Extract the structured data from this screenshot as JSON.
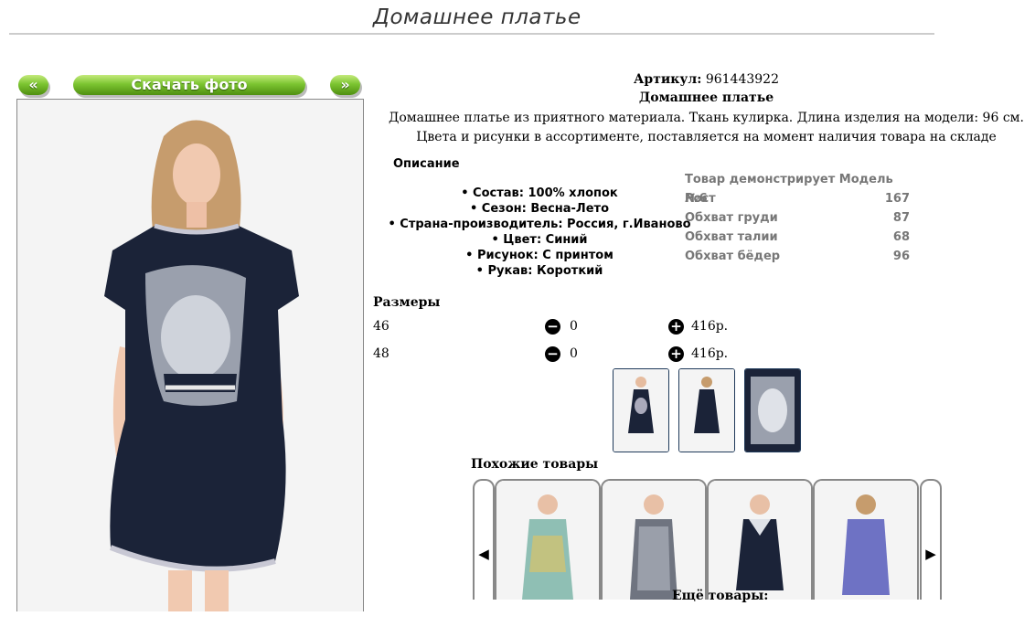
{
  "page_title": "Домашнее платье",
  "nav": {
    "prev_label": "«",
    "download_label": "Скачать фото",
    "next_label": "»"
  },
  "product": {
    "article_label": "Артикул:",
    "article_value": "961443922",
    "name": "Домашнее платье",
    "description": "Домашнее платье из приятного материала. Ткань кулирка. Длина изделия на модели: 96 см. Цвета и рисунки в ассортименте, поставляется на момент наличия товара на складе"
  },
  "description_section": {
    "heading": "Описание",
    "items": [
      "• Состав: 100% хлопок",
      "• Сезон: Весна-Лето",
      "• Страна-производитель: Россия, г.Иваново",
      "• Цвет: Синий",
      "• Рисунок: С принтом",
      "• Рукав: Короткий"
    ]
  },
  "model_table": {
    "heading": "Товар демонстрирует Модель №6",
    "rows": [
      {
        "label": "Рост",
        "value": "167"
      },
      {
        "label": "Обхват груди",
        "value": "87"
      },
      {
        "label": "Обхват талии",
        "value": "68"
      },
      {
        "label": "Обхват бёдер",
        "value": "96"
      }
    ]
  },
  "sizes": {
    "heading": "Размеры",
    "rows": [
      {
        "size": "46",
        "quantity": "0",
        "price": "416р."
      },
      {
        "size": "48",
        "quantity": "0",
        "price": "416р."
      }
    ]
  },
  "similar": {
    "heading": "Похожие товары",
    "prev_icon": "◀",
    "next_icon": "▶",
    "more_label": "Ещё товары:"
  },
  "colors": {
    "accent_green": "#6db526",
    "dress_navy": "#1b2338",
    "thumb_border": "#1f3a5a"
  }
}
